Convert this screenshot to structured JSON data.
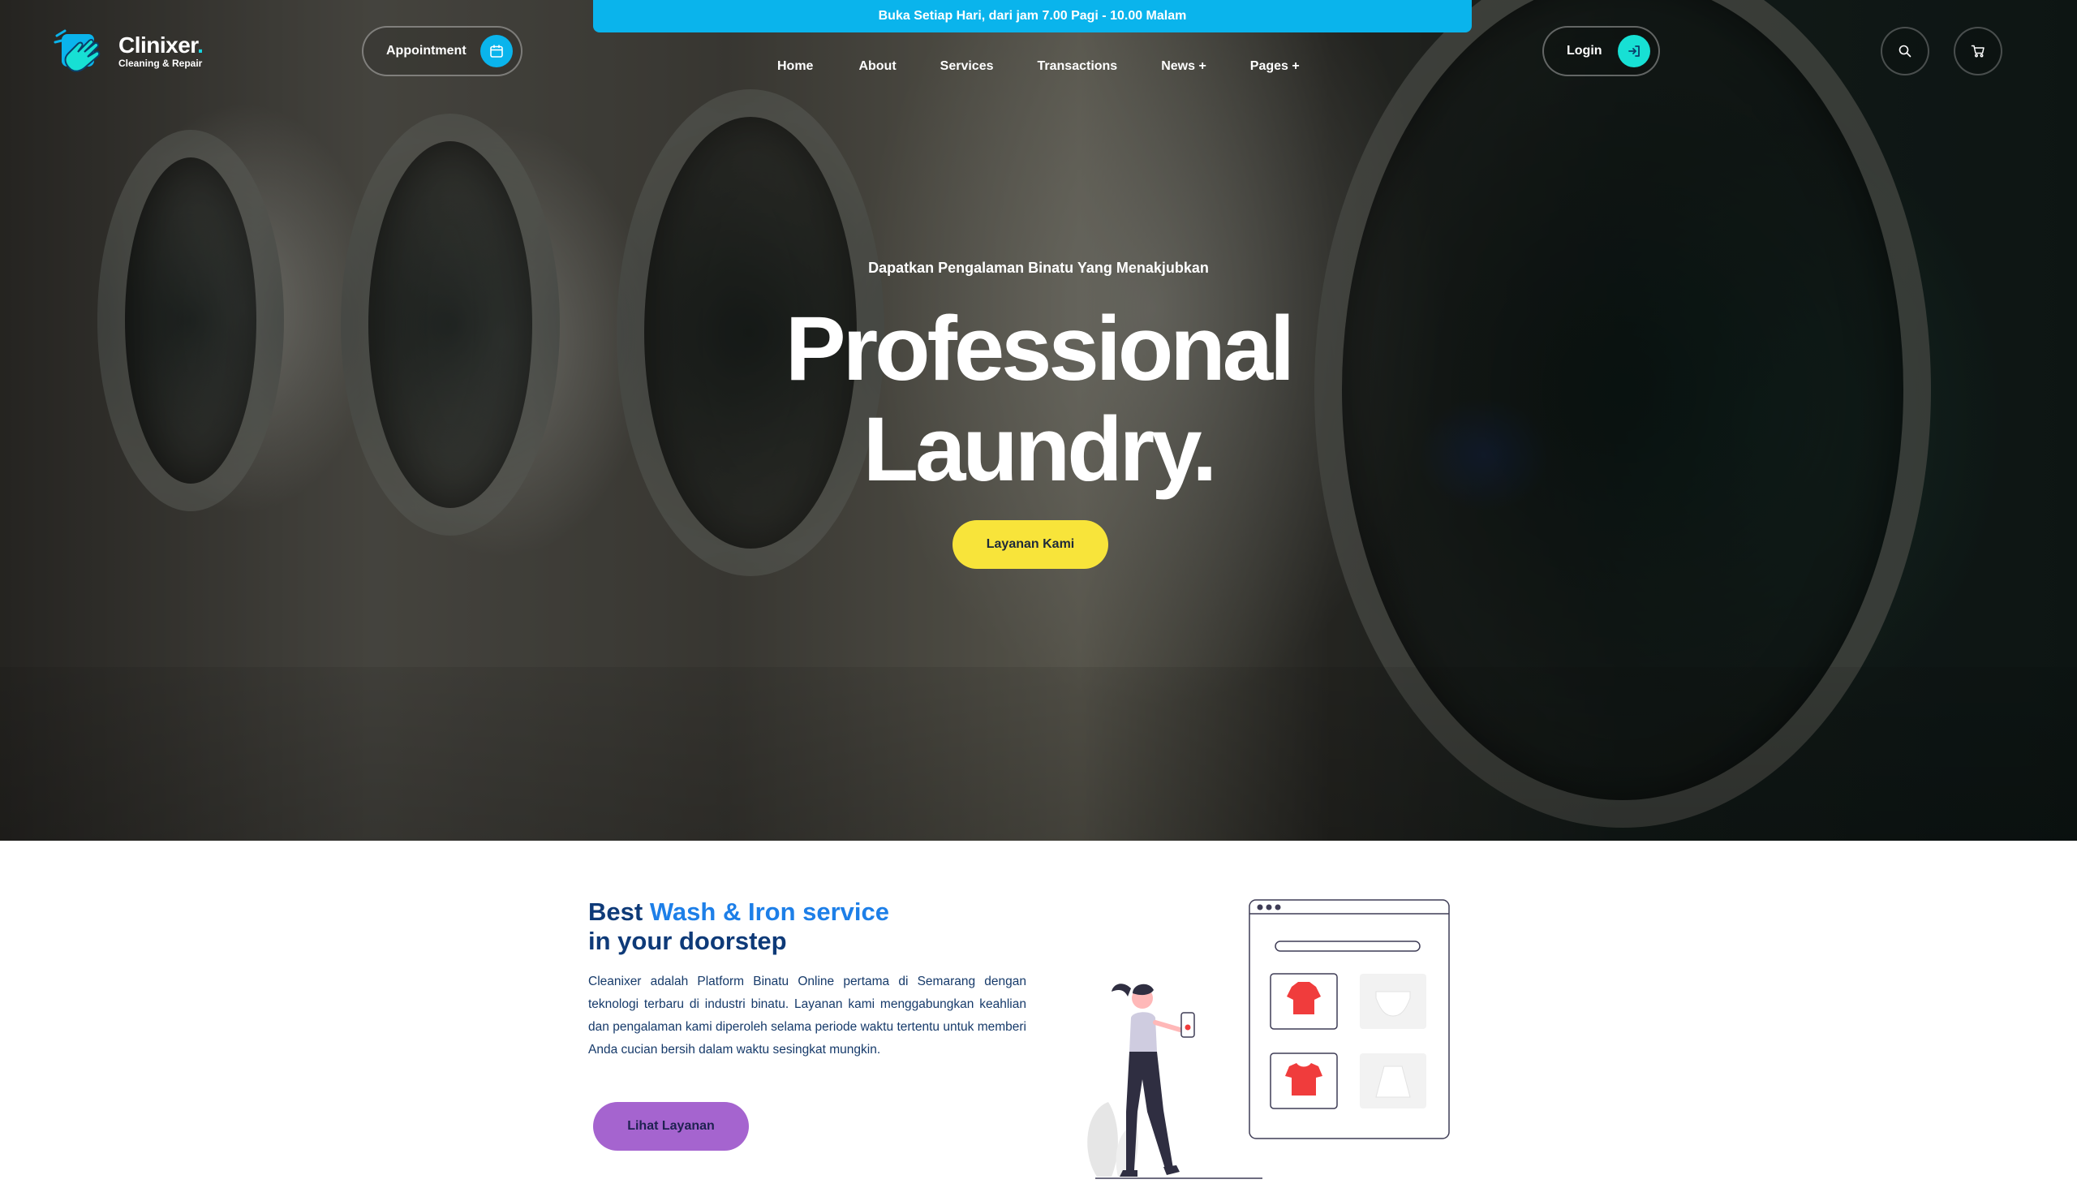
{
  "banner": {
    "text": "Buka Setiap Hari, dari jam 7.00 Pagi - 10.00 Malam"
  },
  "brand": {
    "name": "Clinixer",
    "dot": ".",
    "tagline": "Cleaning & Repair"
  },
  "header": {
    "appointment_label": "Appointment",
    "login_label": "Login",
    "nav": [
      {
        "label": "Home"
      },
      {
        "label": "About"
      },
      {
        "label": "Services"
      },
      {
        "label": "Transactions"
      },
      {
        "label": "News +"
      },
      {
        "label": "Pages +"
      }
    ],
    "icons": {
      "appointment": "calendar-icon",
      "login": "login-arrow-icon",
      "search": "search-icon",
      "cart": "cart-icon"
    }
  },
  "hero": {
    "subtitle": "Dapatkan Pengalaman Binatu Yang Menakjubkan",
    "title_line1": "Professional",
    "title_line2": "Laundry.",
    "cta_label": "Layanan Kami"
  },
  "about": {
    "heading_prefix": "Best ",
    "heading_accent": "Wash & Iron service",
    "heading_line2": "in your doorstep",
    "body": "Cleanixer adalah Platform Binatu Online pertama di Semarang dengan teknologi terbaru di industri binatu. Layanan kami menggabungkan keahlian dan pengalaman kami diperoleh selama periode waktu tertentu untuk memberi Anda cucian bersih dalam waktu sesingkat mungkin.",
    "cta_label": "Lihat Layanan"
  },
  "colors": {
    "banner": "#0ab4ec",
    "accent_cyan": "#17e0d4",
    "cta_yellow": "#f8e43a",
    "cta_purple": "#a564cf",
    "heading_navy": "#0e3a78",
    "heading_blue": "#1d7fe8",
    "clothing_red": "#f03c3c"
  }
}
